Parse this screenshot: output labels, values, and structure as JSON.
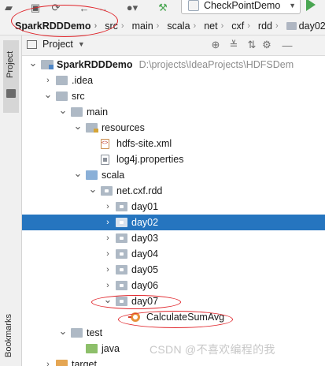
{
  "toolbar": {
    "icons": [
      "open-folder-icon",
      "save-icon",
      "sync-icon",
      "back-icon",
      "forward-icon",
      "user-icon",
      "hammer-icon"
    ],
    "run_config": "CheckPointDemo",
    "run_icon": "run-icon"
  },
  "breadcrumb": [
    "SparkRDDDemo",
    "src",
    "main",
    "scala",
    "net",
    "cxf",
    "rdd",
    "day02"
  ],
  "side_stripe": {
    "project": "Project",
    "bookmarks": "Bookmarks"
  },
  "project_panel": {
    "title": "Project",
    "actions": [
      "add-icon",
      "collapse-icon",
      "sort-icon",
      "gear-icon",
      "minimize-icon"
    ]
  },
  "tree": [
    {
      "label": "SparkRDDDemo",
      "path": "D:\\projects\\IdeaProjects\\HDFSDem",
      "icon": "module",
      "indent": 0,
      "expanded": true
    },
    {
      "label": ".idea",
      "icon": "folder",
      "indent": 1,
      "expanded": false
    },
    {
      "label": "src",
      "icon": "folder",
      "indent": 1,
      "expanded": true
    },
    {
      "label": "main",
      "icon": "folder",
      "indent": 2,
      "expanded": true
    },
    {
      "label": "resources",
      "icon": "folder-res",
      "indent": 3,
      "expanded": true
    },
    {
      "label": "hdfs-site.xml",
      "icon": "file-xml",
      "indent": 4
    },
    {
      "label": "log4j.properties",
      "icon": "file-props",
      "indent": 4
    },
    {
      "label": "scala",
      "icon": "folder-src",
      "indent": 3,
      "expanded": true
    },
    {
      "label": "net.cxf.rdd",
      "icon": "pkg",
      "indent": 4,
      "expanded": true
    },
    {
      "label": "day01",
      "icon": "pkg",
      "indent": 5,
      "expanded": false
    },
    {
      "label": "day02",
      "icon": "pkg",
      "indent": 5,
      "expanded": false,
      "selected": true
    },
    {
      "label": "day03",
      "icon": "pkg",
      "indent": 5,
      "expanded": false
    },
    {
      "label": "day04",
      "icon": "pkg",
      "indent": 5,
      "expanded": false
    },
    {
      "label": "day05",
      "icon": "pkg",
      "indent": 5,
      "expanded": false
    },
    {
      "label": "day06",
      "icon": "pkg",
      "indent": 5,
      "expanded": false
    },
    {
      "label": "day07",
      "icon": "pkg",
      "indent": 5,
      "expanded": true
    },
    {
      "label": "CalculateSumAvg",
      "icon": "scala-obj",
      "indent": 6
    },
    {
      "label": "test",
      "icon": "folder",
      "indent": 2,
      "expanded": true
    },
    {
      "label": "java",
      "icon": "folder-test",
      "indent": 3
    },
    {
      "label": "target",
      "icon": "folder-target",
      "indent": 1,
      "expanded": false
    }
  ],
  "watermark": "CSDN @不喜欢编程的我",
  "colors": {
    "selection": "#2675bf",
    "annotation": "#e0242a"
  }
}
